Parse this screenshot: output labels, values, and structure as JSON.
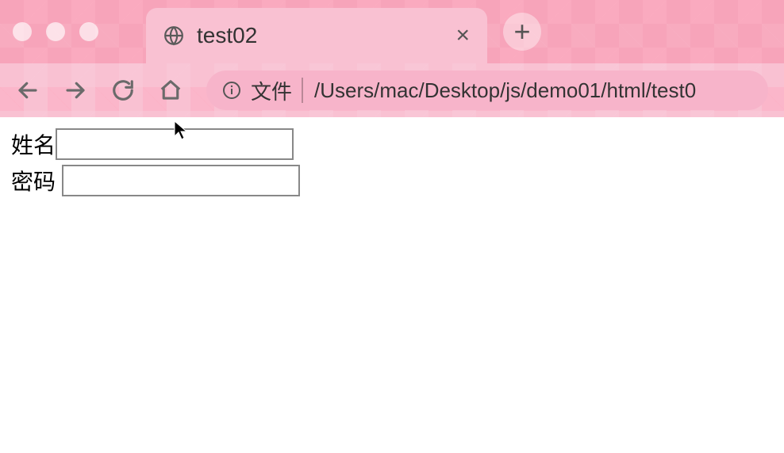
{
  "browser": {
    "tab": {
      "title": "test02",
      "favicon": "globe-icon"
    },
    "address": {
      "scheme_label": "文件",
      "path": "/Users/mac/Desktop/js/demo01/html/test0"
    }
  },
  "page": {
    "form": {
      "name_label": "姓名",
      "name_value": "",
      "password_label": "密码",
      "password_value": ""
    }
  }
}
